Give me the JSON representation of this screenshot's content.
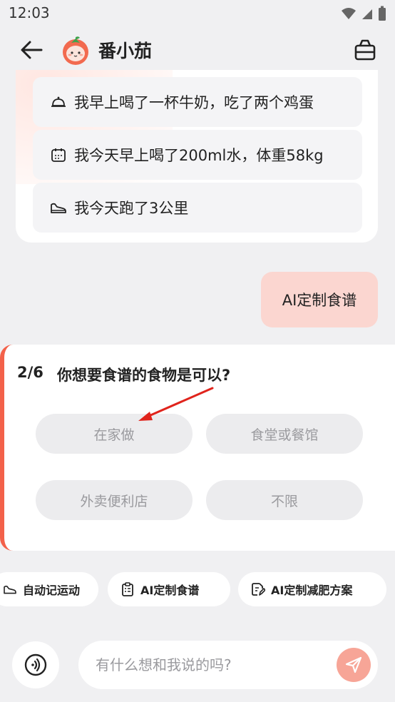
{
  "status_bar": {
    "time": "12:03"
  },
  "header": {
    "title": "番小茄"
  },
  "suggestions": [
    {
      "icon": "food-cloche-icon",
      "text": "我早上喝了一杯牛奶，吃了两个鸡蛋"
    },
    {
      "icon": "calendar-icon",
      "text": "我今天早上喝了200ml水，体重58kg"
    },
    {
      "icon": "sneaker-icon",
      "text": "我今天跑了3公里"
    }
  ],
  "user_message": "AI定制食谱",
  "question": {
    "progress": "2/6",
    "text": "你想要食谱的食物是可以?",
    "options": [
      "在家做",
      "食堂或餐馆",
      "外卖便利店",
      "不限"
    ]
  },
  "quick_actions": [
    {
      "icon": "sneaker-icon",
      "label": "自动记运动"
    },
    {
      "icon": "clipboard-icon",
      "label": "AI定制食谱"
    },
    {
      "icon": "document-edit-icon",
      "label": "AI定制减肥方案"
    }
  ],
  "input": {
    "placeholder": "有什么想和我说的吗?"
  },
  "colors": {
    "accent": "#f3614a",
    "bubble": "#fbd6d0",
    "send": "#f7a597"
  }
}
